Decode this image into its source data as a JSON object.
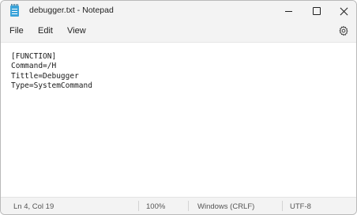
{
  "window": {
    "title": "debugger.txt - Notepad",
    "icons": {
      "app": "notepad-icon",
      "minimize": "minimize-icon",
      "maximize": "maximize-icon",
      "close": "close-icon",
      "settings": "gear-icon"
    }
  },
  "menu": {
    "file": "File",
    "edit": "Edit",
    "view": "View"
  },
  "editor": {
    "lines": [
      "[FUNCTION]",
      "Command=/H",
      "Tittle=Debugger",
      "Type=SystemCommand"
    ]
  },
  "status": {
    "position": "Ln 4, Col 19",
    "zoom": "100%",
    "line_ending": "Windows (CRLF)",
    "encoding": "UTF-8"
  }
}
